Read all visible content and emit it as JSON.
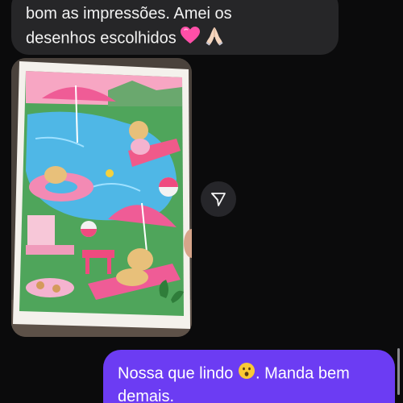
{
  "incoming_message": {
    "line1": "bom as impressões. Amei os",
    "line2": "desenhos escolhidos",
    "emojis": [
      "pink-heart",
      "folded-hands"
    ]
  },
  "shared_photo": {
    "description_icon": "coloring-book-photo"
  },
  "share_button": {
    "icon": "send-arrow-icon"
  },
  "outgoing_message": {
    "line1_text": "Nossa que lindo",
    "line1_tail": ". Manda bem",
    "line2": "demais.",
    "emoji": "astonished-face"
  },
  "colors": {
    "background": "#0b0b0c",
    "incoming_bubble": "#262628",
    "outgoing_bubble": "#6c3cf3"
  }
}
